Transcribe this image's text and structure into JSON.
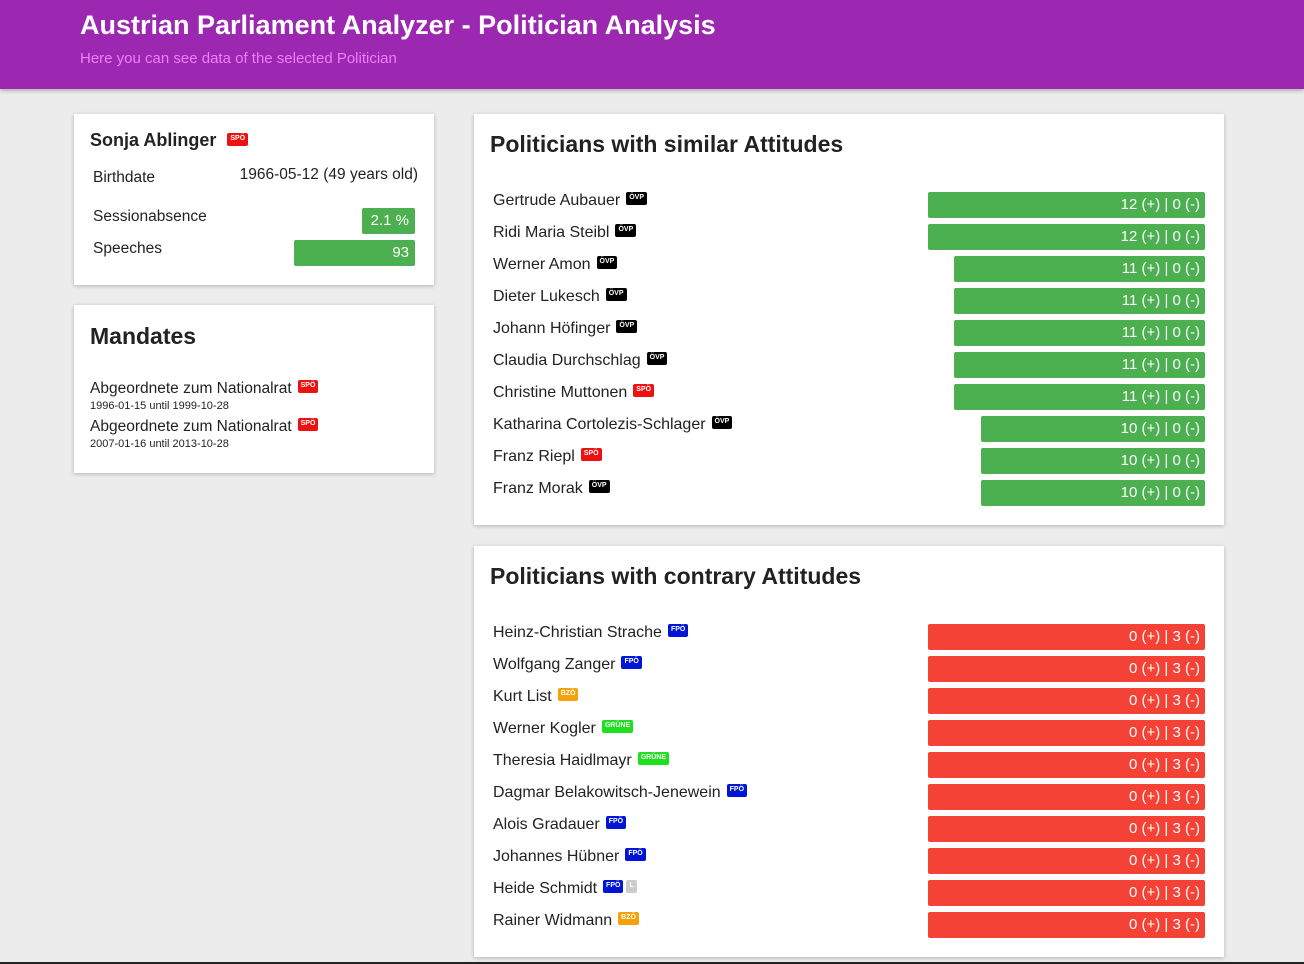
{
  "header": {
    "title": "Austrian Parliament Analyzer - Politician Analysis",
    "subtitle": "Here you can see data of the selected Politician"
  },
  "politician": {
    "name": "Sonja Ablinger",
    "party": "SPÖ",
    "birthdate_label": "Birthdate",
    "birthdate_value": "1966-05-12 (49 years old)",
    "sessionabsence_label": "Sessionabsence",
    "sessionabsence_value": "2.1 %",
    "sessionabsence_fraction": 0.2,
    "speeches_label": "Speeches",
    "speeches_value": "93"
  },
  "mandates": {
    "title": "Mandates",
    "items": [
      {
        "name": "Abgeordnete zum Nationalrat",
        "party": "SPÖ",
        "dates": "1996-01-15 until 1999-10-28"
      },
      {
        "name": "Abgeordnete zum Nationalrat",
        "party": "SPÖ",
        "dates": "2007-01-16 until 2013-10-28"
      }
    ]
  },
  "similar": {
    "title": "Politicians with similar Attitudes",
    "items": [
      {
        "name": "Gertrude Aubauer",
        "parties": [
          "ÖVP"
        ],
        "score": "12 (+) | 0 (-)",
        "plus": 12
      },
      {
        "name": "Ridi Maria Steibl",
        "parties": [
          "ÖVP"
        ],
        "score": "12 (+) | 0 (-)",
        "plus": 12
      },
      {
        "name": "Werner Amon",
        "parties": [
          "ÖVP"
        ],
        "score": "11 (+) | 0 (-)",
        "plus": 11
      },
      {
        "name": "Dieter Lukesch",
        "parties": [
          "ÖVP"
        ],
        "score": "11 (+) | 0 (-)",
        "plus": 11
      },
      {
        "name": "Johann Höfinger",
        "parties": [
          "ÖVP"
        ],
        "score": "11 (+) | 0 (-)",
        "plus": 11
      },
      {
        "name": "Claudia Durchschlag",
        "parties": [
          "ÖVP"
        ],
        "score": "11 (+) | 0 (-)",
        "plus": 11
      },
      {
        "name": "Christine Muttonen",
        "parties": [
          "SPÖ"
        ],
        "score": "11 (+) | 0 (-)",
        "plus": 11
      },
      {
        "name": "Katharina Cortolezis-Schlager",
        "parties": [
          "ÖVP"
        ],
        "score": "10 (+) | 0 (-)",
        "plus": 10
      },
      {
        "name": "Franz Riepl",
        "parties": [
          "SPÖ"
        ],
        "score": "10 (+) | 0 (-)",
        "plus": 10
      },
      {
        "name": "Franz Morak",
        "parties": [
          "ÖVP"
        ],
        "score": "10 (+) | 0 (-)",
        "plus": 10
      }
    ]
  },
  "contrary": {
    "title": "Politicians with contrary Attitudes",
    "items": [
      {
        "name": "Heinz-Christian Strache",
        "parties": [
          "FPÖ"
        ],
        "score": "0 (+) | 3 (-)",
        "minus": 3
      },
      {
        "name": "Wolfgang Zanger",
        "parties": [
          "FPÖ"
        ],
        "score": "0 (+) | 3 (-)",
        "minus": 3
      },
      {
        "name": "Kurt List",
        "parties": [
          "BZÖ"
        ],
        "score": "0 (+) | 3 (-)",
        "minus": 3
      },
      {
        "name": "Werner Kogler",
        "parties": [
          "GRÜNE"
        ],
        "score": "0 (+) | 3 (-)",
        "minus": 3
      },
      {
        "name": "Theresia Haidlmayr",
        "parties": [
          "GRÜNE"
        ],
        "score": "0 (+) | 3 (-)",
        "minus": 3
      },
      {
        "name": "Dagmar Belakowitsch-Jenewein",
        "parties": [
          "FPÖ"
        ],
        "score": "0 (+) | 3 (-)",
        "minus": 3
      },
      {
        "name": "Alois Gradauer",
        "parties": [
          "FPÖ"
        ],
        "score": "0 (+) | 3 (-)",
        "minus": 3
      },
      {
        "name": "Johannes Hübner",
        "parties": [
          "FPÖ"
        ],
        "score": "0 (+) | 3 (-)",
        "minus": 3
      },
      {
        "name": "Heide Schmidt",
        "parties": [
          "FPÖ",
          "L"
        ],
        "score": "0 (+) | 3 (-)",
        "minus": 3
      },
      {
        "name": "Rainer Widmann",
        "parties": [
          "BZÖ"
        ],
        "score": "0 (+) | 3 (-)",
        "minus": 3
      }
    ]
  },
  "colors": {
    "header": "#9c27b0",
    "positive": "#4caf50",
    "negative": "#f44336",
    "party_OVP": "#000000",
    "party_SPO": "#ee1111",
    "party_FPO": "#0015d6",
    "party_BZO": "#f5a20a",
    "party_GRUNE": "#1fe01f",
    "party_L": "#cccccc"
  }
}
